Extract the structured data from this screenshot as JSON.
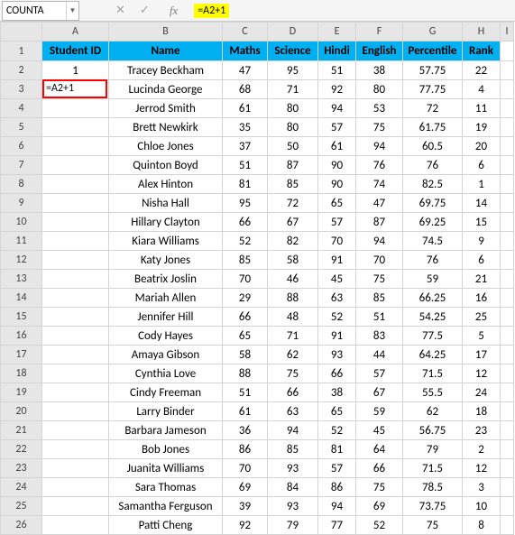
{
  "namebox": "COUNTA",
  "formula": "=A2+1",
  "icons": {
    "cancel": "✕",
    "enter": "✓",
    "fx": "fx",
    "dropdown": "▼"
  },
  "columns": [
    "A",
    "B",
    "C",
    "D",
    "E",
    "F",
    "G",
    "H",
    "I"
  ],
  "rows": [
    "1",
    "2",
    "3",
    "4",
    "5",
    "6",
    "7",
    "8",
    "9",
    "10",
    "11",
    "12",
    "13",
    "14",
    "15",
    "16",
    "17",
    "18",
    "19",
    "20",
    "21",
    "22",
    "23",
    "24",
    "25",
    "26"
  ],
  "headers": [
    "Student ID",
    "Name",
    "Maths",
    "Science",
    "Hindi",
    "English",
    "Percentile",
    "Rank"
  ],
  "a3_display": "=A2+1",
  "data": [
    [
      "1",
      "Tracey Beckham",
      "47",
      "95",
      "51",
      "38",
      "57.75",
      "22"
    ],
    [
      "",
      "Lucinda George",
      "68",
      "71",
      "92",
      "80",
      "77.75",
      "4"
    ],
    [
      "",
      "Jerrod Smith",
      "61",
      "80",
      "94",
      "53",
      "72",
      "11"
    ],
    [
      "",
      "Brett Newkirk",
      "35",
      "80",
      "57",
      "75",
      "61.75",
      "19"
    ],
    [
      "",
      "Chloe Jones",
      "37",
      "50",
      "61",
      "94",
      "60.5",
      "20"
    ],
    [
      "",
      "Quinton Boyd",
      "51",
      "87",
      "90",
      "76",
      "76",
      "6"
    ],
    [
      "",
      "Alex Hinton",
      "81",
      "85",
      "90",
      "74",
      "82.5",
      "1"
    ],
    [
      "",
      "Nisha Hall",
      "95",
      "72",
      "65",
      "47",
      "69.75",
      "14"
    ],
    [
      "",
      "Hillary Clayton",
      "66",
      "67",
      "57",
      "87",
      "69.25",
      "15"
    ],
    [
      "",
      "Kiara Williams",
      "52",
      "82",
      "70",
      "94",
      "74.5",
      "9"
    ],
    [
      "",
      "Katy Jones",
      "85",
      "58",
      "91",
      "70",
      "76",
      "6"
    ],
    [
      "",
      "Beatrix Joslin",
      "70",
      "46",
      "45",
      "75",
      "59",
      "21"
    ],
    [
      "",
      "Mariah Allen",
      "29",
      "88",
      "63",
      "85",
      "66.25",
      "16"
    ],
    [
      "",
      "Jennifer Hill",
      "66",
      "48",
      "52",
      "51",
      "54.25",
      "25"
    ],
    [
      "",
      "Cody Hayes",
      "65",
      "71",
      "91",
      "83",
      "77.5",
      "5"
    ],
    [
      "",
      "Amaya Gibson",
      "58",
      "62",
      "93",
      "44",
      "64.25",
      "17"
    ],
    [
      "",
      "Cynthia Love",
      "88",
      "75",
      "66",
      "57",
      "71.5",
      "12"
    ],
    [
      "",
      "Cindy Freeman",
      "51",
      "66",
      "38",
      "67",
      "55.5",
      "24"
    ],
    [
      "",
      "Larry Binder",
      "61",
      "63",
      "65",
      "59",
      "62",
      "18"
    ],
    [
      "",
      "Barbara Jameson",
      "36",
      "94",
      "52",
      "45",
      "56.75",
      "23"
    ],
    [
      "",
      "Bob Jones",
      "86",
      "85",
      "81",
      "64",
      "79",
      "2"
    ],
    [
      "",
      "Juanita Williams",
      "70",
      "93",
      "57",
      "66",
      "71.5",
      "12"
    ],
    [
      "",
      "Sara Thomas",
      "69",
      "84",
      "86",
      "75",
      "78.5",
      "3"
    ],
    [
      "",
      "Samantha Ferguson",
      "39",
      "93",
      "94",
      "69",
      "73.75",
      "10"
    ],
    [
      "",
      "Patti Cheng",
      "92",
      "79",
      "77",
      "52",
      "75",
      "8"
    ]
  ]
}
